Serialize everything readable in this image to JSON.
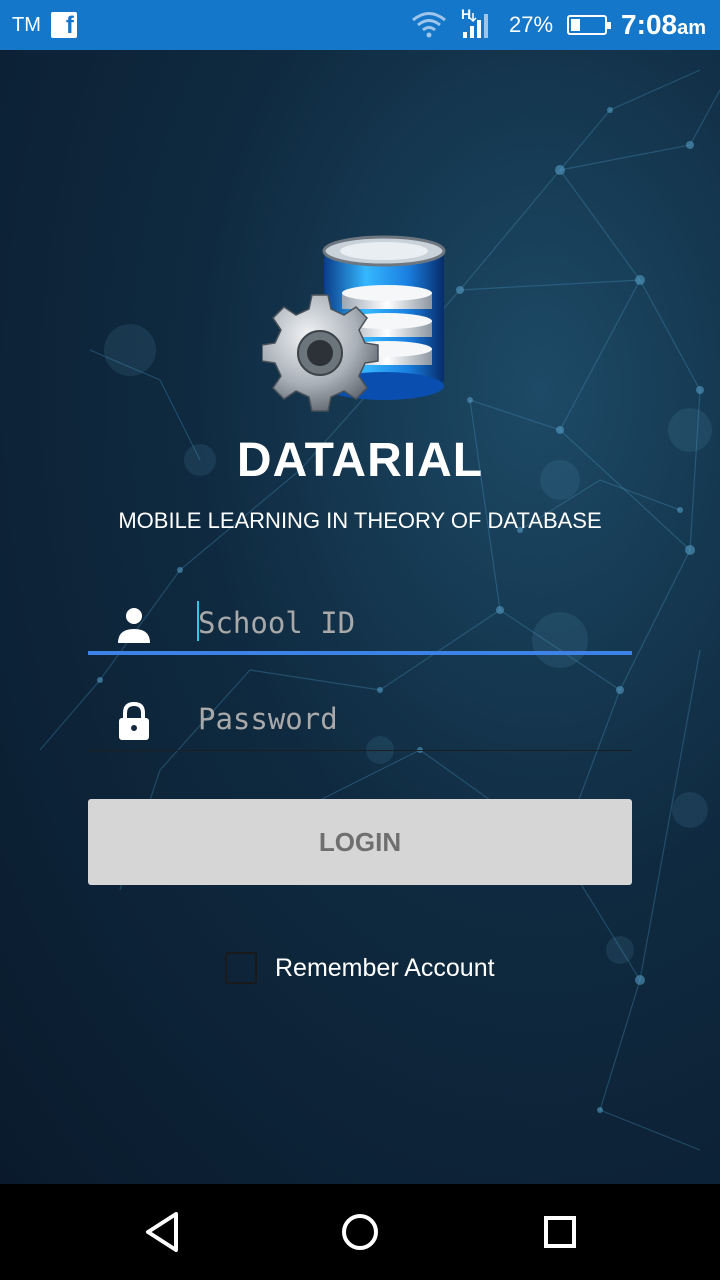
{
  "status_bar": {
    "carrier": "TM",
    "battery_percent": "27%",
    "battery_level": 0.27,
    "time": "7:08",
    "time_suffix": "am",
    "network": "H"
  },
  "app": {
    "title": "DATARIAL",
    "subtitle": "MOBILE LEARNING IN THEORY OF DATABASE"
  },
  "form": {
    "school_id": {
      "value": "",
      "placeholder": "School ID",
      "icon": "person-icon"
    },
    "password": {
      "value": "",
      "placeholder": "Password",
      "icon": "lock-icon"
    },
    "login_label": "LOGIN",
    "remember_label": "Remember Account",
    "remember_checked": false
  },
  "colors": {
    "status_bar": "#1477c9",
    "accent": "#3d82e6",
    "button_bg": "#d6d6d6",
    "button_text": "#6f6f6f"
  },
  "nav_bar": {
    "icons": [
      "back-icon",
      "home-icon",
      "recents-icon"
    ]
  }
}
